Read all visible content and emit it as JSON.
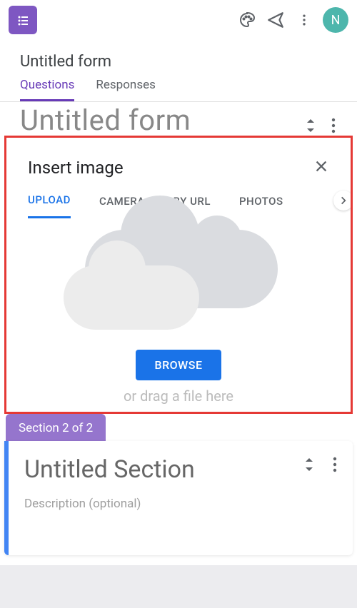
{
  "header": {
    "avatar_initial": "N"
  },
  "doc_title": "Untitled form",
  "tabs": {
    "questions": "Questions",
    "responses": "Responses"
  },
  "form_title": "Untitled form",
  "modal": {
    "title": "Insert image",
    "tabs": {
      "upload": "UPLOAD",
      "camera": "CAMERA",
      "by_url": "BY URL",
      "photos": "PHOTOS"
    },
    "browse_label": "BROWSE",
    "drag_hint": "or drag a file here"
  },
  "section": {
    "chip": "Section 2 of 2",
    "title": "Untitled Section",
    "description_placeholder": "Description (optional)"
  }
}
